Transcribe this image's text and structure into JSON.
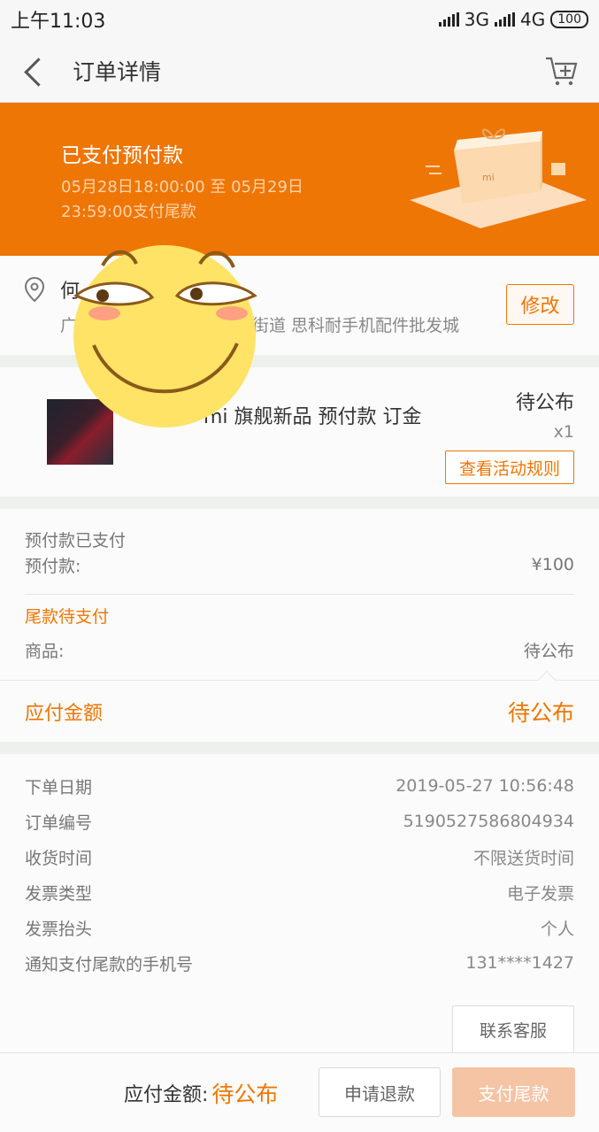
{
  "statusbar": {
    "time": "上午11:03",
    "net1": "3G",
    "net2": "4G",
    "net2_sub": "ıl",
    "battery": "100"
  },
  "nav": {
    "title": "订单详情",
    "back_icon": "back-arrow-icon",
    "cart_icon": "cart-add-icon"
  },
  "banner": {
    "title": "已支付预付款",
    "desc_line1": "05月28日18:00:00 至 05月29日",
    "desc_line2": "23:59:00支付尾款",
    "bg": "#ee7605",
    "box_logo": "mi"
  },
  "address": {
    "name": "何",
    "line": "广",
    "line_tail": "街道 思科耐手机配件批发城",
    "edit": "修改"
  },
  "product": {
    "name": "mi 旗舰新品 预付款 订金",
    "price": "待公布",
    "qty": "x1",
    "rule_button": "查看活动规则"
  },
  "payment": {
    "prepaid_title": "预付款已支付",
    "prepaid_label": "预付款:",
    "prepaid_value": "¥100",
    "balance_title": "尾款待支付",
    "goods_label": "商品:",
    "goods_value": "待公布"
  },
  "due": {
    "label": "应付金额",
    "value": "待公布"
  },
  "info": [
    {
      "label": "下单日期",
      "value": "2019-05-27 10:56:48"
    },
    {
      "label": "订单编号",
      "value": "5190527586804934"
    },
    {
      "label": "收货时间",
      "value": "不限送货时间"
    },
    {
      "label": "发票类型",
      "value": "电子发票"
    },
    {
      "label": "发票抬头",
      "value": "个人"
    },
    {
      "label": "通知支付尾款的手机号",
      "value": "131****1427"
    }
  ],
  "service_button": "联系客服",
  "footer": {
    "label": "应付金额:",
    "value": "待公布",
    "refund": "申请退款",
    "pay": "支付尾款"
  },
  "colors": {
    "accent": "#ee7605",
    "pay_button_disabled": "#f5c4a5"
  }
}
